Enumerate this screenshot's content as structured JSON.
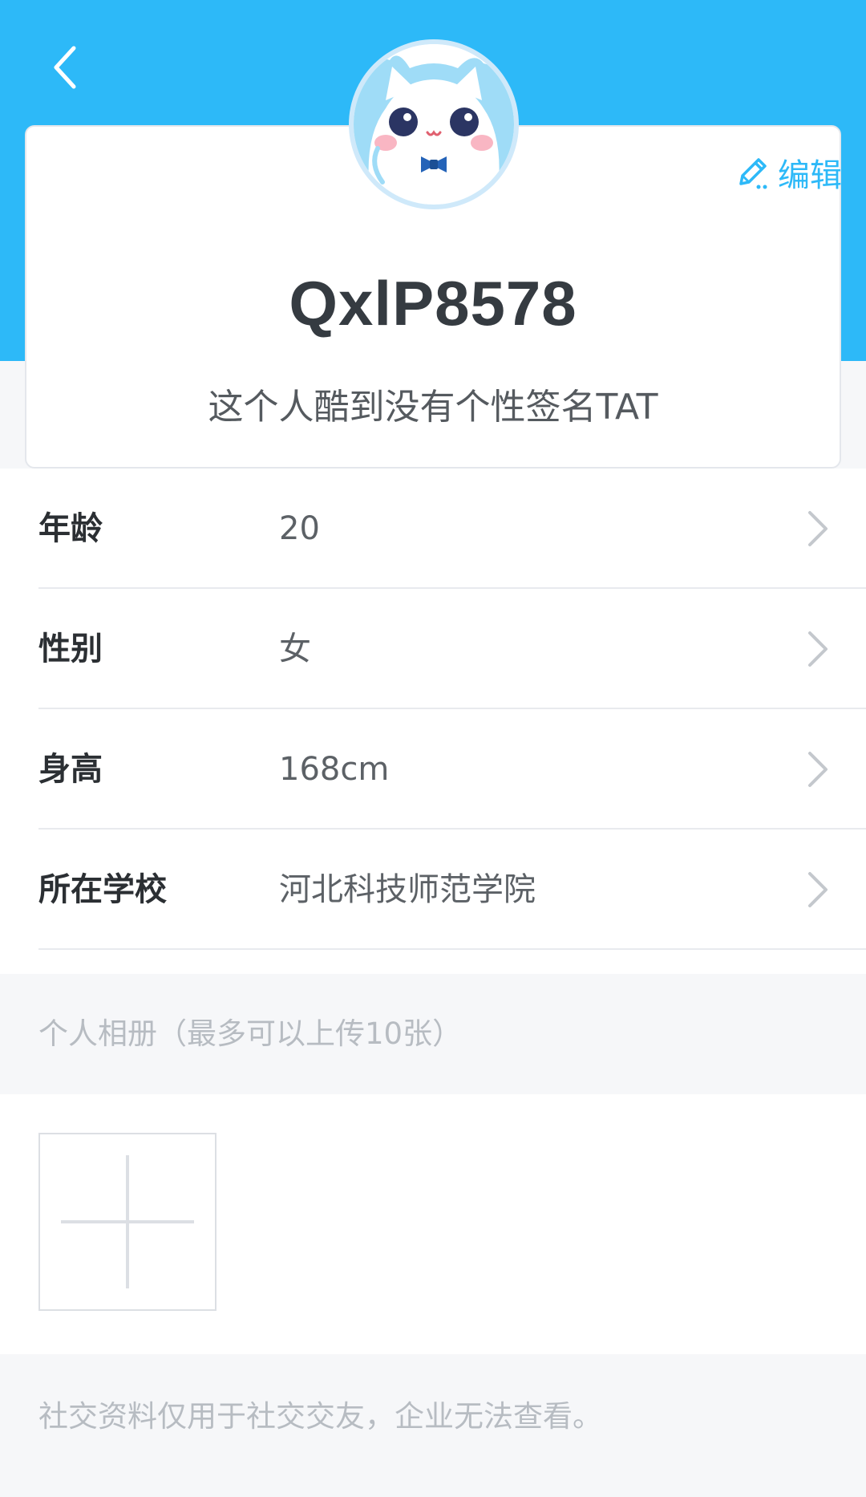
{
  "header": {
    "back_icon": "chevron-left-icon",
    "accent_color": "#2db9f8"
  },
  "profile": {
    "avatar_icon": "cat-mascot-avatar",
    "edit_icon": "pencil-icon",
    "edit_label": "编辑",
    "username": "QxlP8578",
    "signature": "这个人酷到没有个性签名TAT"
  },
  "info": [
    {
      "label": "年龄",
      "value": "20"
    },
    {
      "label": "性别",
      "value": "女"
    },
    {
      "label": "身高",
      "value": "168cm"
    },
    {
      "label": "所在学校",
      "value": "河北科技师范学院"
    }
  ],
  "album": {
    "title": "个人相册（最多可以上传10张）",
    "add_icon": "plus-icon"
  },
  "footer": {
    "note": "社交资料仅用于社交交友，企业无法查看。"
  }
}
